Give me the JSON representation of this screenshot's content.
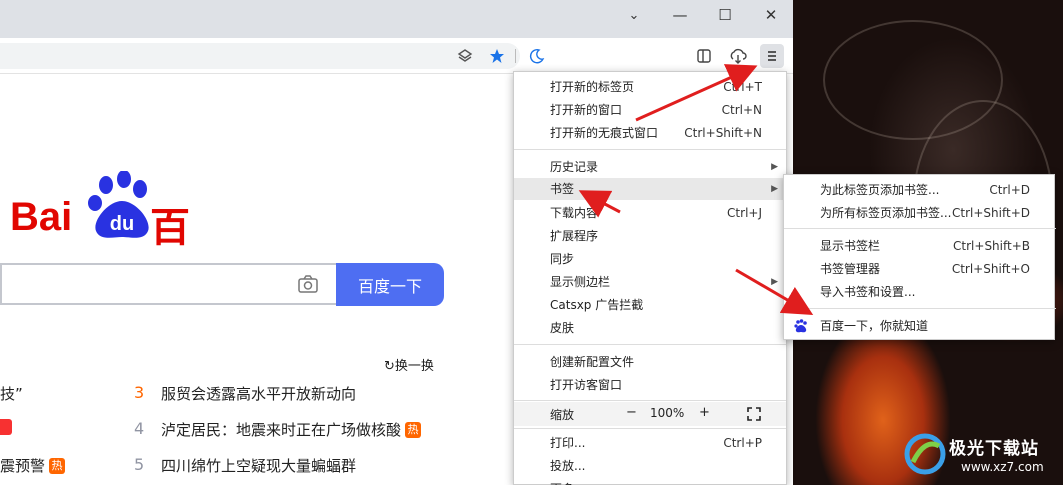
{
  "window_controls": {
    "minimize": "—",
    "maximize": "☐",
    "close": "✕",
    "dropdown": "⌄"
  },
  "toolbar_icons": [
    "layers-icon",
    "star-icon",
    "moon-icon",
    "sidebar-icon",
    "download-icon",
    "menu-icon"
  ],
  "baidu": {
    "logo_left": "Bai",
    "logo_paw": "du",
    "logo_right": "百度",
    "search_button": "百度一下",
    "refresh_label": "换一换",
    "hot_items": [
      {
        "num": "",
        "text": "技”",
        "badge": ""
      },
      {
        "num": "3",
        "text": "服贸会透露高水平开放新动向",
        "badge": ""
      },
      {
        "num": "",
        "text": "",
        "badge": ""
      },
      {
        "num": "4",
        "text": "泸定居民：地震来时正在广场做核酸",
        "badge": "热"
      },
      {
        "num": "",
        "text": "震预警",
        "badge": "热"
      },
      {
        "num": "5",
        "text": "四川绵竹上空疑现大量蝙蝠群",
        "badge": ""
      }
    ]
  },
  "menu": {
    "items": [
      {
        "label": "打开新的标签页",
        "shortcut": "Ctrl+T"
      },
      {
        "label": "打开新的窗口",
        "shortcut": "Ctrl+N"
      },
      {
        "label": "打开新的无痕式窗口",
        "shortcut": "Ctrl+Shift+N"
      },
      {
        "label": "历史记录",
        "shortcut": ""
      },
      {
        "label": "书签",
        "shortcut": ""
      },
      {
        "label": "下载内容",
        "shortcut": "Ctrl+J"
      },
      {
        "label": "扩展程序",
        "shortcut": ""
      },
      {
        "label": "同步",
        "shortcut": ""
      },
      {
        "label": "显示侧边栏",
        "shortcut": ""
      },
      {
        "label": "Catsxp 广告拦截",
        "shortcut": ""
      },
      {
        "label": "皮肤",
        "shortcut": ""
      },
      {
        "label": "创建新配置文件",
        "shortcut": ""
      },
      {
        "label": "打开访客窗口",
        "shortcut": ""
      },
      {
        "label": "打印...",
        "shortcut": "Ctrl+P"
      },
      {
        "label": "投放...",
        "shortcut": ""
      },
      {
        "label": "更多",
        "shortcut": ""
      }
    ],
    "zoom": {
      "label": "缩放",
      "minus": "−",
      "value": "100%",
      "plus": "+"
    }
  },
  "bookmarks_submenu": {
    "items": [
      {
        "label": "为此标签页添加书签...",
        "shortcut": "Ctrl+D"
      },
      {
        "label": "为所有标签页添加书签...",
        "shortcut": "Ctrl+Shift+D"
      },
      {
        "label": "显示书签栏",
        "shortcut": "Ctrl+Shift+B"
      },
      {
        "label": "书签管理器",
        "shortcut": "Ctrl+Shift+O"
      },
      {
        "label": "导入书签和设置...",
        "shortcut": ""
      },
      {
        "label": "百度一下，你就知道",
        "shortcut": ""
      }
    ]
  },
  "watermark": {
    "title": "极光下载站",
    "url": "www.xz7.com"
  },
  "colors": {
    "annotation_arrow": "#e01e1e",
    "baidu_red": "#e10601",
    "baidu_blue": "#2932e1",
    "search_button": "#4e6ef2"
  }
}
